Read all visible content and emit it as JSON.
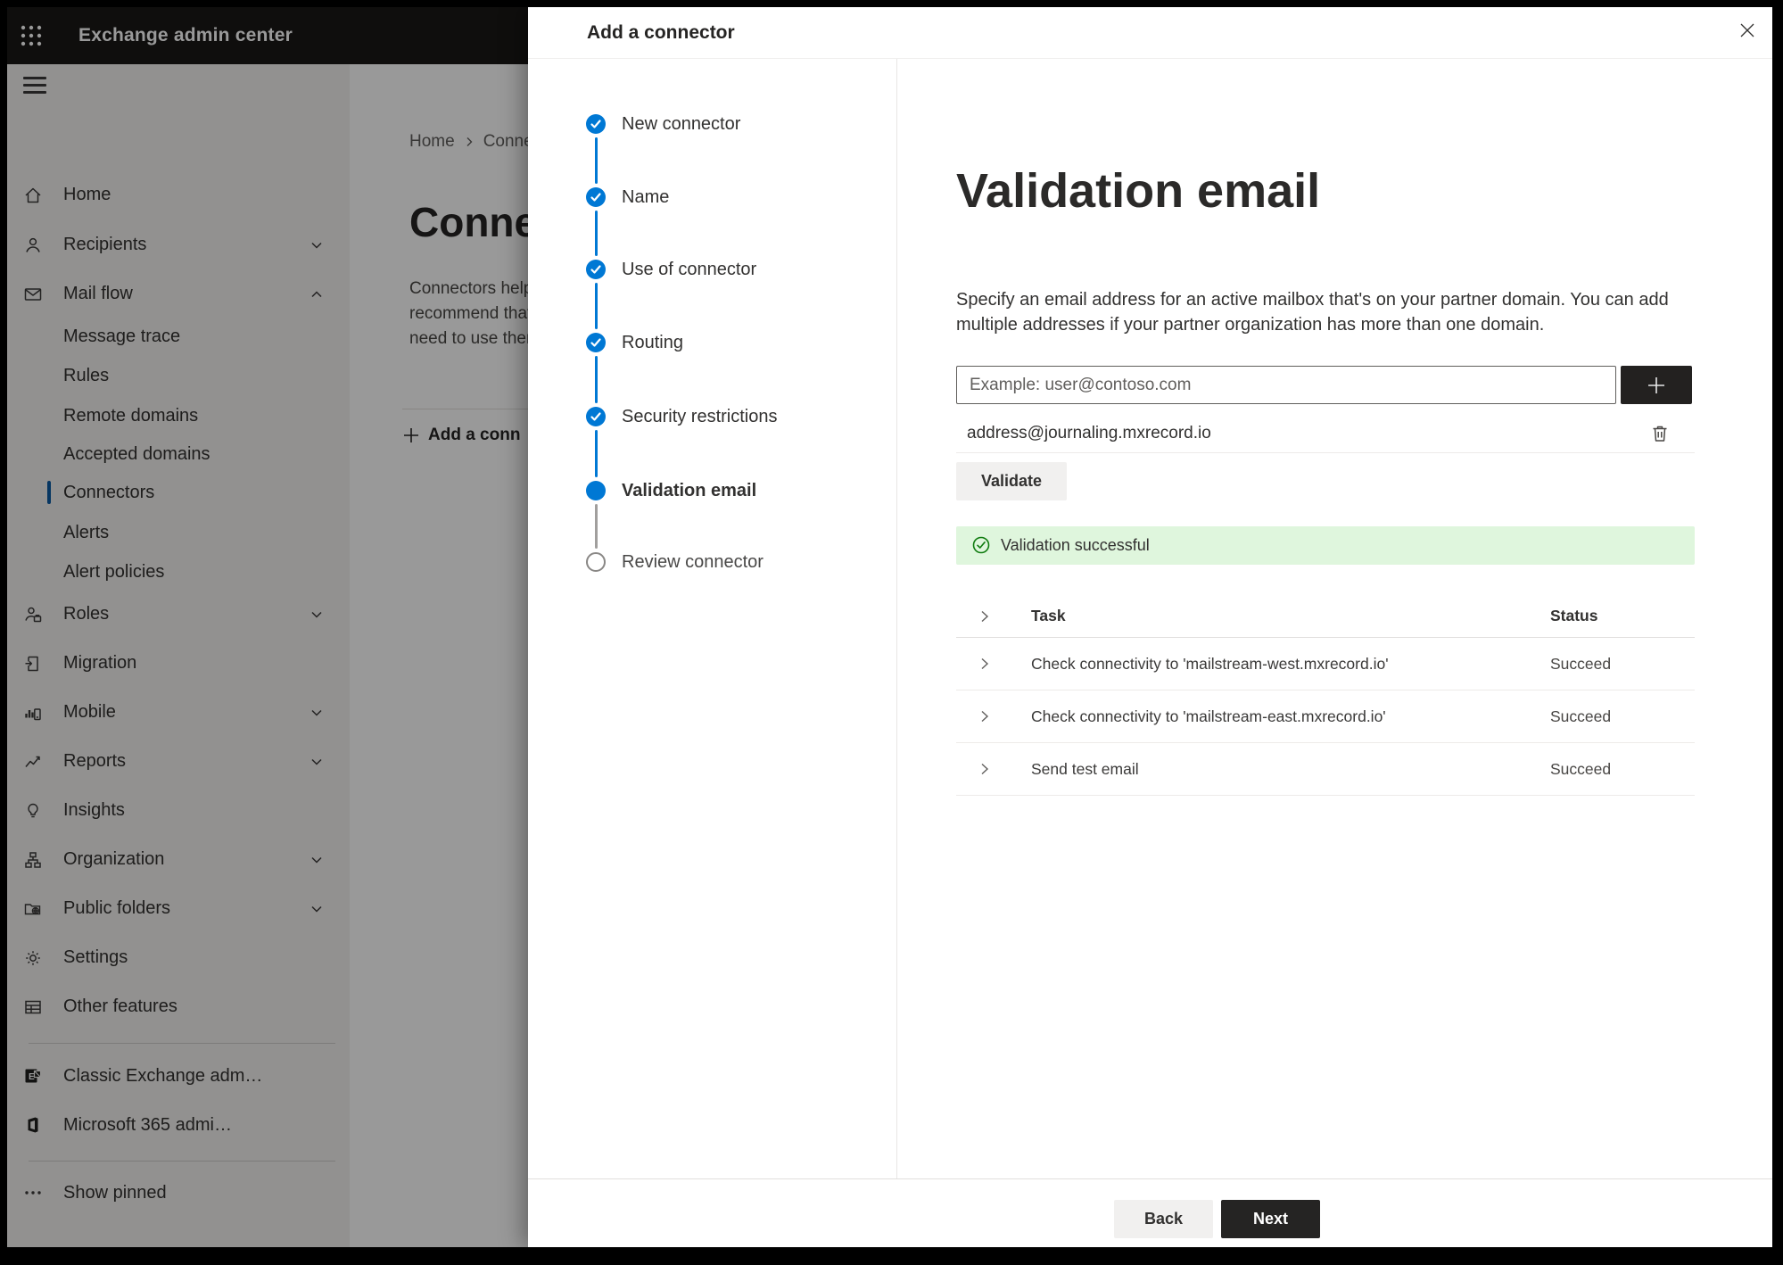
{
  "app": {
    "title": "Exchange admin center"
  },
  "breadcrumb": {
    "items": [
      "Home",
      "Conne"
    ]
  },
  "page": {
    "title": "Connect",
    "description_lines": [
      "Connectors help",
      "recommend that",
      "need to use ther"
    ],
    "add_button_label": "Add a conn",
    "status_column_label": "Status"
  },
  "sidebar": {
    "items": [
      {
        "label": "Home",
        "icon": "home-icon"
      },
      {
        "label": "Recipients",
        "icon": "person-icon",
        "chevron": "down"
      },
      {
        "label": "Mail flow",
        "icon": "mail-icon",
        "chevron": "up",
        "expanded": true
      },
      {
        "label": "Message trace",
        "sub": true
      },
      {
        "label": "Rules",
        "sub": true
      },
      {
        "label": "Remote domains",
        "sub": true
      },
      {
        "label": "Accepted domains",
        "sub": true
      },
      {
        "label": "Connectors",
        "sub": true,
        "selected": true
      },
      {
        "label": "Alerts",
        "sub": true
      },
      {
        "label": "Alert policies",
        "sub": true
      },
      {
        "label": "Roles",
        "icon": "roles-icon",
        "chevron": "down"
      },
      {
        "label": "Migration",
        "icon": "migration-icon"
      },
      {
        "label": "Mobile",
        "icon": "mobile-icon",
        "chevron": "down"
      },
      {
        "label": "Reports",
        "icon": "reports-icon",
        "chevron": "down"
      },
      {
        "label": "Insights",
        "icon": "insights-icon"
      },
      {
        "label": "Organization",
        "icon": "organization-icon",
        "chevron": "down"
      },
      {
        "label": "Public folders",
        "icon": "public-folders-icon",
        "chevron": "down"
      },
      {
        "label": "Settings",
        "icon": "settings-icon"
      },
      {
        "label": "Other features",
        "icon": "other-features-icon"
      },
      {
        "label": "Classic Exchange adm…",
        "icon": "classic-exchange-icon"
      },
      {
        "label": "Microsoft 365 admi…",
        "icon": "microsoft-365-icon"
      },
      {
        "label": "Show pinned",
        "icon": "ellipsis-icon"
      }
    ]
  },
  "dialog": {
    "title": "Add a connector",
    "steps": [
      {
        "label": "New connector",
        "state": "complete"
      },
      {
        "label": "Name",
        "state": "complete"
      },
      {
        "label": "Use of connector",
        "state": "complete"
      },
      {
        "label": "Routing",
        "state": "complete"
      },
      {
        "label": "Security restrictions",
        "state": "complete"
      },
      {
        "label": "Validation email",
        "state": "current"
      },
      {
        "label": "Review connector",
        "state": "upcoming"
      }
    ],
    "content": {
      "heading": "Validation email",
      "description": "Specify an email address for an active mailbox that's on your partner domain. You can add multiple addresses if your partner organization has more than one domain.",
      "email_input_placeholder": "Example: user@contoso.com",
      "added_address": "address@journaling.mxrecord.io",
      "validate_button": "Validate",
      "success_message": "Validation successful",
      "results_table": {
        "columns": [
          "Task",
          "Status"
        ],
        "rows": [
          {
            "task": "Check connectivity to 'mailstream-west.mxrecord.io'",
            "status": "Succeed"
          },
          {
            "task": "Check connectivity to 'mailstream-east.mxrecord.io'",
            "status": "Succeed"
          },
          {
            "task": "Send test email",
            "status": "Succeed"
          }
        ]
      }
    },
    "footer": {
      "back": "Back",
      "next": "Next"
    }
  },
  "colors": {
    "accent_blue": "#0078d4",
    "success_green": "#107c10",
    "success_banner_bg": "#dff6dd",
    "dark_button": "#252423",
    "header_bg": "#191817",
    "sidebar_bg": "#f3f2f1"
  }
}
